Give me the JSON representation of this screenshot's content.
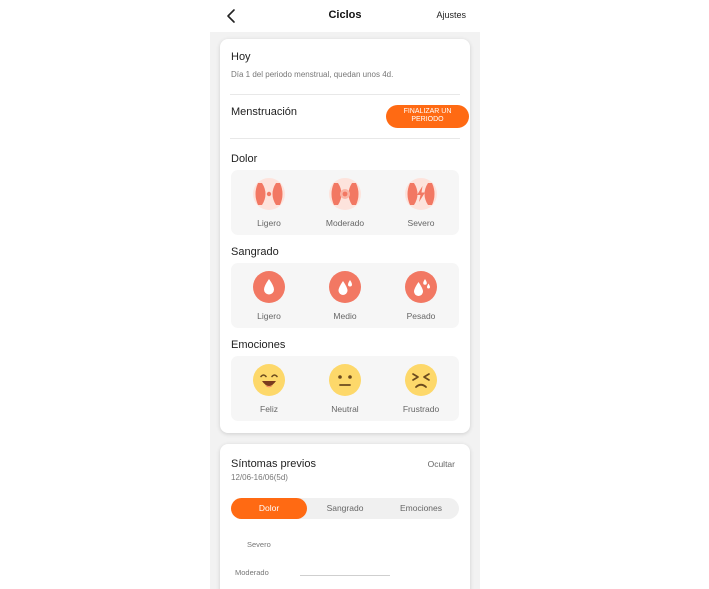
{
  "header": {
    "title": "Ciclos",
    "settings_label": "Ajustes"
  },
  "today": {
    "title": "Hoy",
    "subtitle": "Día 1 del periodo menstrual, quedan unos 4d."
  },
  "menstruation": {
    "label": "Menstruación",
    "end_button_line1": "FINALIZAR UN",
    "end_button_line2": "PERIODO"
  },
  "pain": {
    "title": "Dolor",
    "options": [
      {
        "label": "Ligero",
        "icon": "pain-light-icon"
      },
      {
        "label": "Moderado",
        "icon": "pain-moderate-icon"
      },
      {
        "label": "Severo",
        "icon": "pain-severe-icon"
      }
    ]
  },
  "bleeding": {
    "title": "Sangrado",
    "options": [
      {
        "label": "Ligero",
        "icon": "drop-light-icon"
      },
      {
        "label": "Medio",
        "icon": "drop-medium-icon"
      },
      {
        "label": "Pesado",
        "icon": "drop-heavy-icon"
      }
    ]
  },
  "emotions": {
    "title": "Emociones",
    "options": [
      {
        "label": "Feliz",
        "icon": "happy-face-icon"
      },
      {
        "label": "Neutral",
        "icon": "neutral-face-icon"
      },
      {
        "label": "Frustrado",
        "icon": "frustrated-face-icon"
      }
    ]
  },
  "previous": {
    "title": "Síntomas previos",
    "range": "12/06-16/06(5d)",
    "hide_label": "Ocultar",
    "tabs": [
      "Dolor",
      "Sangrado",
      "Emociones"
    ],
    "active_tab": "Dolor",
    "axis_labels": [
      "Severo",
      "Moderado"
    ]
  },
  "colors": {
    "accent": "#ff6a13",
    "icon_light": "#fde3dc",
    "icon_main": "#f27863",
    "emoji_face": "#fdd86a"
  }
}
